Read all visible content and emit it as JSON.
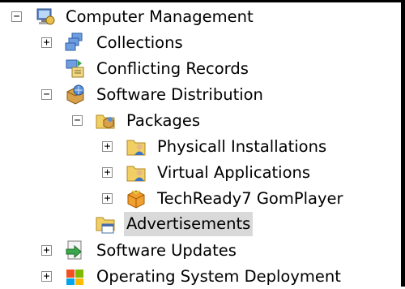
{
  "tree": {
    "computer_management": "Computer Management",
    "collections": "Collections",
    "conflicting_records": "Conflicting Records",
    "software_distribution": "Software Distribution",
    "packages": "Packages",
    "physicall_installations": "Physicall Installations",
    "virtual_applications": "Virtual Applications",
    "techready_gomplayer": "TechReady7 GomPlayer",
    "advertisements": "Advertisements",
    "software_updates": "Software Updates",
    "os_deployment": "Operating System Deployment"
  },
  "toggles": {
    "expanded": "−",
    "collapsed": "+"
  },
  "selected_item": "Advertisements"
}
